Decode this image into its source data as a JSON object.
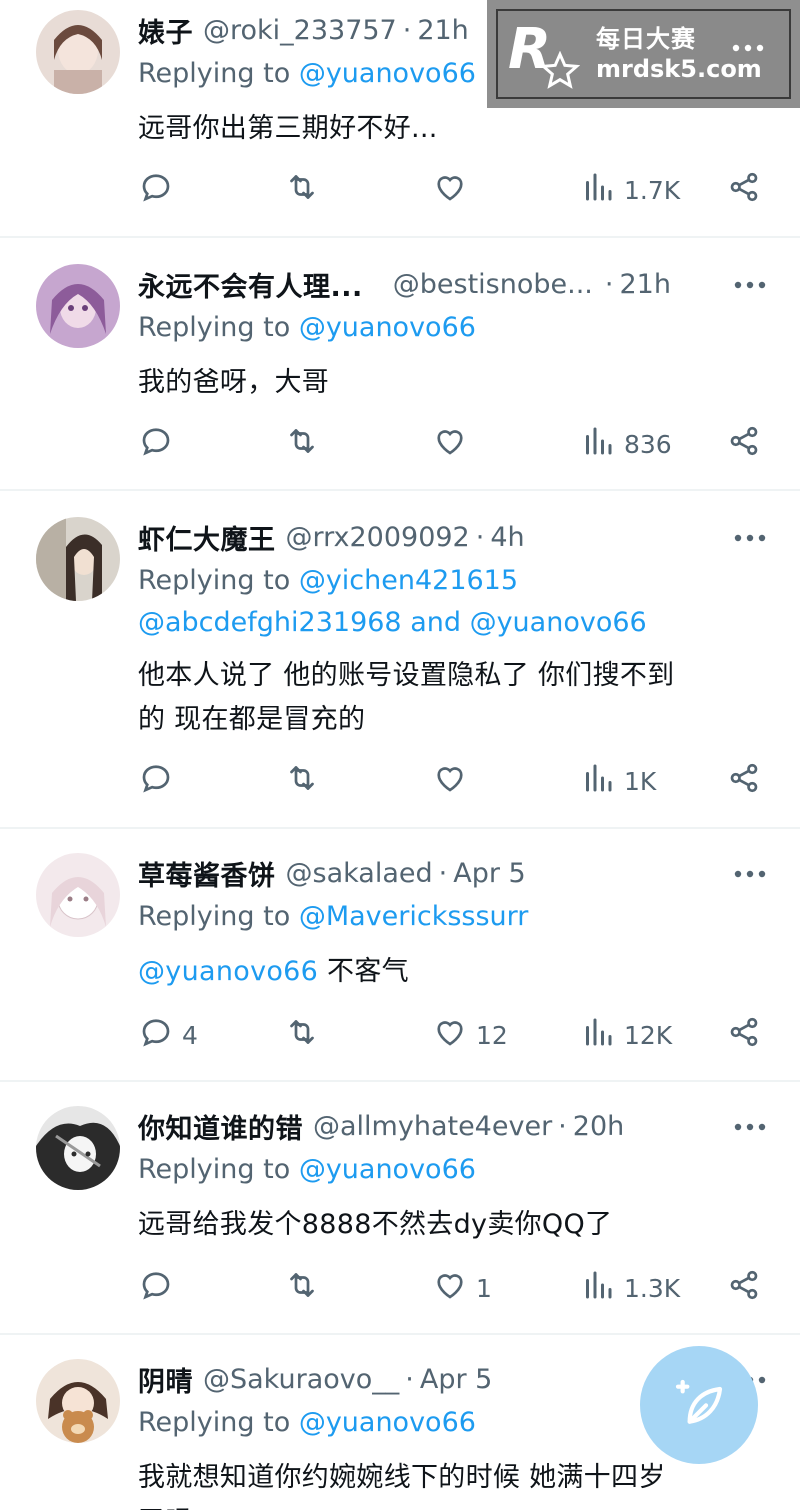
{
  "watermark": {
    "logo_letter": "R",
    "line1": "每日大赛",
    "line2": "mrdsk5.com"
  },
  "icons": {
    "reply": "reply-icon",
    "retweet": "retweet-icon",
    "like": "like-icon",
    "views": "views-icon",
    "share": "share-icon",
    "more": "more-icon",
    "compose": "compose-icon"
  },
  "colors": {
    "mention": "#1d9bf0",
    "secondary_text": "#536471",
    "compose_button": "#a6d6f5"
  },
  "tweets": [
    {
      "name": "婊子",
      "handle": "@roki_233757",
      "sep": "·",
      "time": "21h",
      "replying_prefix": "Replying to ",
      "replying_to": "@yuanovo66",
      "replying_to_line2": "",
      "body": [
        "远哥你出第三期好不好..."
      ],
      "body_mention": "",
      "replies": "",
      "likes": "",
      "views": "1.7K"
    },
    {
      "name": "永远不会有人理...",
      "handle": "@bestisnobe...",
      "sep": "·",
      "time": "21h",
      "replying_prefix": "Replying to ",
      "replying_to": "@yuanovo66",
      "replying_to_line2": "",
      "body": [
        "我的爸呀，大哥"
      ],
      "body_mention": "",
      "replies": "",
      "likes": "",
      "views": "836"
    },
    {
      "name": "虾仁大魔王",
      "handle": "@rrx2009092",
      "sep": "·",
      "time": "4h",
      "replying_prefix": "Replying to ",
      "replying_to": "@yichen421615",
      "replying_to_line2": "@abcdefghi231968 and @yuanovo66",
      "body": [
        "他本人说了 他的账号设置隐私了 你们搜不到",
        "的 现在都是冒充的"
      ],
      "body_mention": "",
      "replies": "",
      "likes": "",
      "views": "1K"
    },
    {
      "name": "草莓酱香饼",
      "handle": "@sakalaed",
      "sep": "·",
      "time": "Apr 5",
      "replying_prefix": "Replying to ",
      "replying_to": "@Mavericksssurr",
      "replying_to_line2": "",
      "body": [
        "不客气"
      ],
      "body_mention": "@yuanovo66",
      "replies": "4",
      "likes": "12",
      "views": "12K"
    },
    {
      "name": "你知道谁的错",
      "handle": "@allmyhate4ever",
      "sep": "·",
      "time": "20h",
      "replying_prefix": "Replying to ",
      "replying_to": "@yuanovo66",
      "replying_to_line2": "",
      "body": [
        "远哥给我发个8888不然去dy卖你QQ了"
      ],
      "body_mention": "",
      "replies": "",
      "likes": "1",
      "views": "1.3K"
    },
    {
      "name": "阴晴",
      "handle": "@Sakuraovo__",
      "sep": "·",
      "time": "Apr 5",
      "replying_prefix": "Replying to ",
      "replying_to": "@yuanovo66",
      "replying_to_line2": "",
      "body": [
        "我就想知道你约婉婉线下的时候 她满十四岁",
        "了吗?"
      ],
      "body_mention": "",
      "replies": "",
      "likes": "",
      "views": ""
    }
  ]
}
